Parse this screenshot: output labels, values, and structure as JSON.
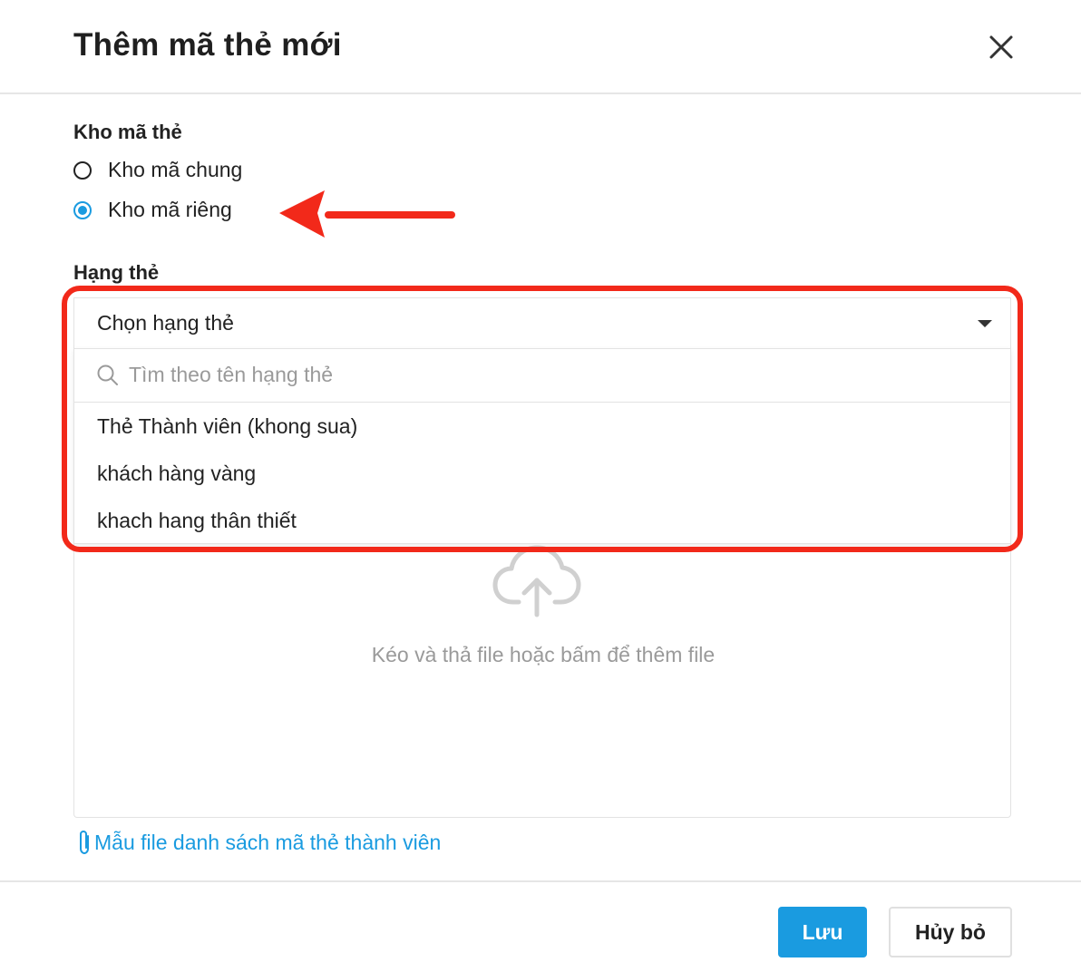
{
  "dialog": {
    "title": "Thêm mã thẻ mới",
    "close_icon": "close-icon"
  },
  "storage": {
    "label": "Kho mã thẻ",
    "options": [
      {
        "label": "Kho mã chung",
        "selected": false
      },
      {
        "label": "Kho mã riêng",
        "selected": true
      }
    ]
  },
  "tier": {
    "label": "Hạng thẻ",
    "select_value": "Chọn hạng thẻ",
    "search_placeholder": "Tìm theo tên hạng thẻ",
    "search_icon": "search-icon",
    "options": [
      "Thẻ Thành viên (khong sua)",
      "khách hàng vàng",
      "khach hang thân thiết"
    ]
  },
  "upload": {
    "icon": "cloud-upload-icon",
    "hint": "Kéo và thả file hoặc bấm để thêm file"
  },
  "template_link": {
    "icon": "paperclip-icon",
    "label": "Mẫu file danh sách mã thẻ thành viên"
  },
  "footer": {
    "save_label": "Lưu",
    "cancel_label": "Hủy bỏ"
  },
  "colors": {
    "accent": "#1a9be0",
    "annotation": "#f2291a"
  }
}
